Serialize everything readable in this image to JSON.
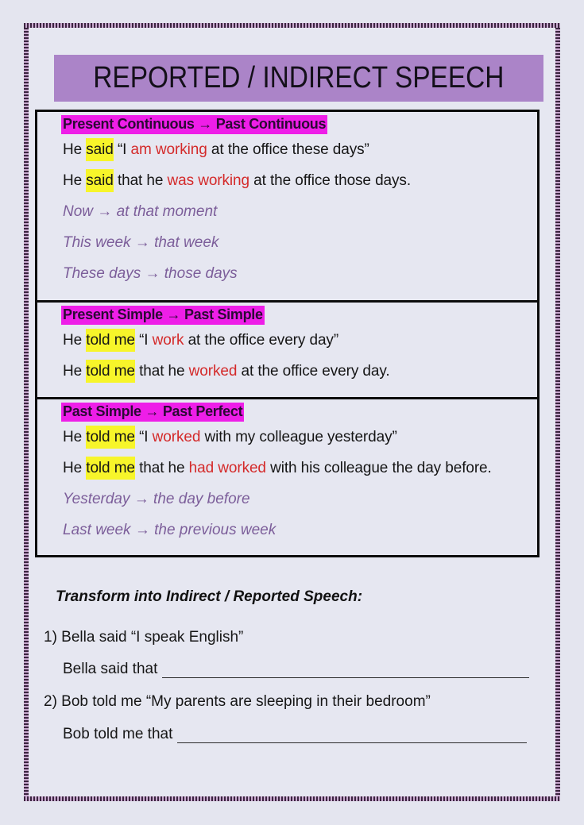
{
  "title": "REPORTED / INDIRECT SPEECH",
  "colors": {
    "banner": "#ab84c8",
    "section_highlight": "#ee1ee8",
    "word_highlight": "#f7f52a",
    "changed_verb": "#d42a2a",
    "time_expression": "#7c5e9a"
  },
  "sections": [
    {
      "heading": "Present Continuous → Past Continuous",
      "direct": {
        "subject": "He",
        "reporting_verb": "said",
        "pre": "“I",
        "verb": "am working",
        "post": "at the office these days”"
      },
      "indirect": {
        "subject": "He",
        "reporting_verb": "said",
        "pre": "that he",
        "verb": "was working",
        "post": "at the office those days."
      },
      "time_changes": [
        "Now → at that moment",
        "This week → that week",
        "These days → those days"
      ]
    },
    {
      "heading": "Present Simple → Past Simple",
      "direct": {
        "subject": "He",
        "reporting_verb": "told me",
        "pre": "“I",
        "verb": "work",
        "post": "at the office every day”"
      },
      "indirect": {
        "subject": "He",
        "reporting_verb": "told me",
        "pre": "that he",
        "verb": "worked",
        "post": "at the office every day."
      },
      "time_changes": []
    },
    {
      "heading": "Past Simple → Past Perfect",
      "direct": {
        "subject": "He",
        "reporting_verb": "told me",
        "pre": "“I",
        "verb": "worked",
        "post": "with my colleague yesterday”"
      },
      "indirect": {
        "subject": "He",
        "reporting_verb": "told me",
        "pre": "that he",
        "verb": "had worked",
        "post": "with his colleague the day before."
      },
      "time_changes": [
        "Yesterday → the day before",
        "Last week → the previous week"
      ]
    }
  ],
  "exercise": {
    "title": "Transform into Indirect / Reported Speech:",
    "questions": [
      {
        "prompt": "1) Bella said “I speak English”",
        "answer_prefix": "Bella said that",
        "answer_value": ""
      },
      {
        "prompt": "2) Bob told me “My parents are sleeping in their bedroom”",
        "answer_prefix": "Bob told me that",
        "answer_value": ""
      }
    ]
  }
}
